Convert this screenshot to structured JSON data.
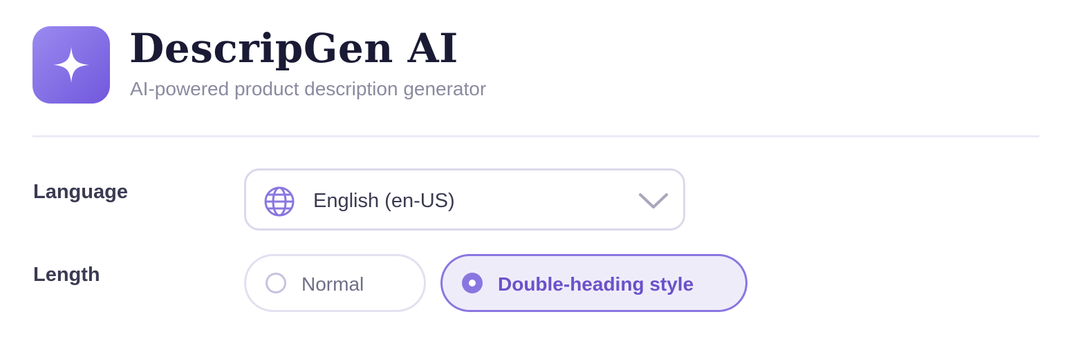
{
  "header": {
    "logo_icon": "sparkle-icon",
    "title": "DescripGen AI",
    "subtitle": "AI-powered product description generator",
    "accent_color": "#7a63e0"
  },
  "language": {
    "label": "Language",
    "selected_value": "English (en-US)",
    "leading_icon": "globe-icon",
    "trailing_icon": "chevron-down-icon"
  },
  "length": {
    "label": "Length",
    "options": [
      {
        "label": "Normal",
        "selected": false
      },
      {
        "label": "Double-heading style",
        "selected": true
      }
    ]
  }
}
